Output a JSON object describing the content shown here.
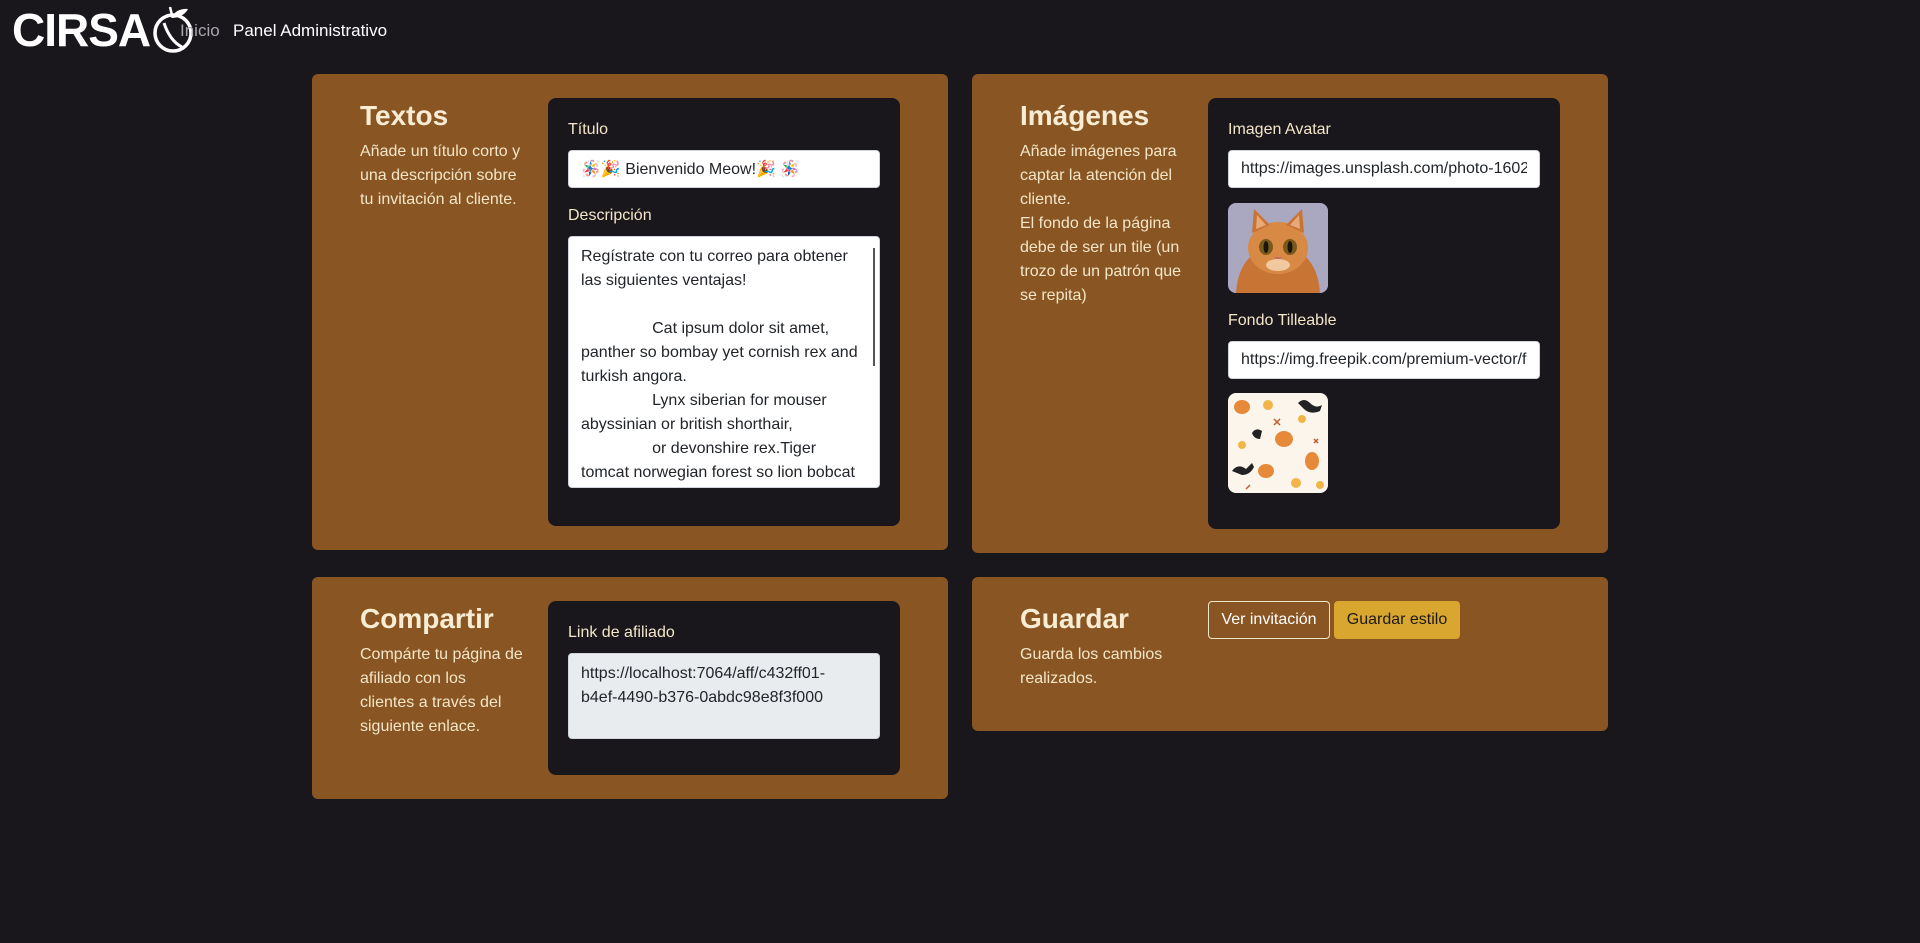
{
  "nav": {
    "brand": "CIRSA",
    "links": [
      "Inicio",
      "Panel Administrativo"
    ]
  },
  "textos": {
    "title": "Textos",
    "description": "Añade un título corto y\nuna descripción sobre\ntu invitación al cliente.",
    "title_label": "Título",
    "title_value": "🪅🎉 Bienvenido Meow!🎉 🪅",
    "desc_label": "Descripción",
    "desc_value": "Regístrate con tu correo para obtener las siguientes ventajas!\n\n                Cat ipsum dolor sit amet, panther so bombay yet cornish rex and turkish angora.\n                Lynx siberian for mouser abyssinian or british shorthair,\n                or devonshire rex.Tiger tomcat norwegian forest so lion bobcat"
  },
  "imagenes": {
    "title": "Imágenes",
    "description": "Añade imágenes para\ncaptar la atención del\ncliente.\nEl fondo de la página\ndebe de ser un tile (un\ntrozo de un patrón que\nse repita)",
    "avatar_label": "Imagen Avatar",
    "avatar_url": "https://images.unsplash.com/photo-1602",
    "fondo_label": "Fondo Tilleable",
    "fondo_url": "https://img.freepik.com/premium-vector/f"
  },
  "compartir": {
    "title": "Compartir",
    "description": "Compárte tu página de\nafiliado con los\nclientes a través del\nsiguiente enlace.",
    "link_label": "Link de afiliado",
    "link_value": "https://localhost:7064/aff/c432ff01-\nb4ef-4490-b376-0abdc98e8f3f000"
  },
  "guardar": {
    "title": "Guardar",
    "description": "Guarda los cambios\nrealizados.",
    "ver_label": "Ver invitación",
    "guardar_label": "Guardar estilo"
  }
}
